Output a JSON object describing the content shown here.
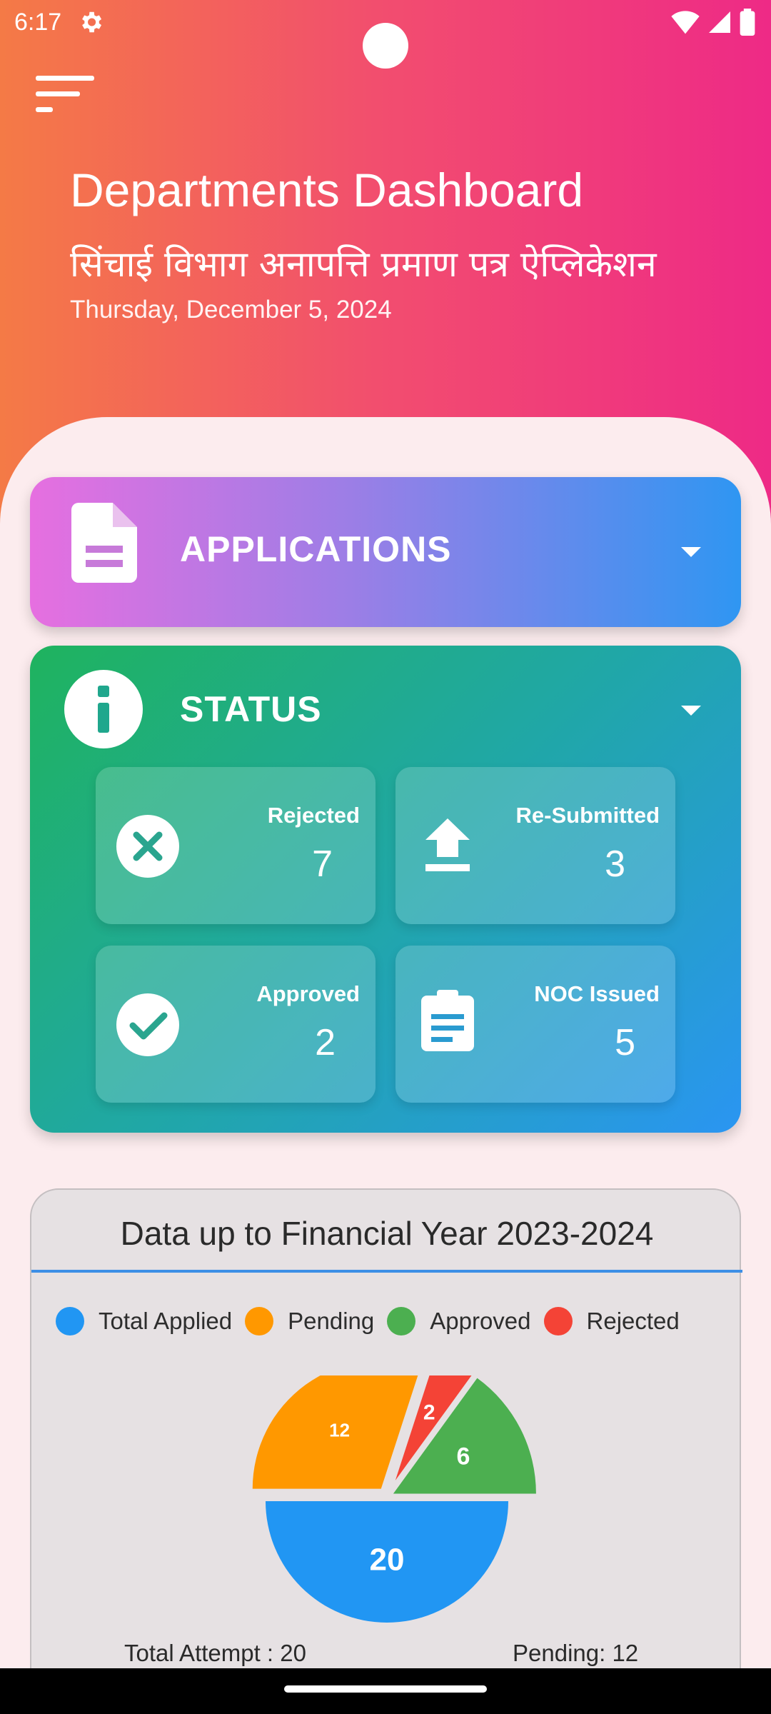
{
  "status_bar": {
    "time": "6:17"
  },
  "header": {
    "title": "Departments Dashboard",
    "subtitle": "सिंचाई विभाग अनापत्ति प्रमाण पत्र ऐप्लिकेशन",
    "date": "Thursday, December 5, 2024"
  },
  "applications": {
    "label": "APPLICATIONS"
  },
  "status": {
    "label": "STATUS",
    "tiles": [
      {
        "label": "Rejected",
        "value": "7",
        "icon": "close-circle-icon"
      },
      {
        "label": "Re-Submitted",
        "value": "3",
        "icon": "upload-icon"
      },
      {
        "label": "Approved",
        "value": "2",
        "icon": "check-circle-icon"
      },
      {
        "label": "NOC Issued",
        "value": "5",
        "icon": "clipboard-icon"
      }
    ]
  },
  "chart": {
    "title": "Data up to Financial Year 2023-2024",
    "footer_left": "Total Attempt : 20",
    "footer_right": "Pending: 12"
  },
  "colors": {
    "total_applied": "#2196f3",
    "pending": "#ff9800",
    "approved": "#4caf50",
    "rejected": "#f44336"
  },
  "chart_data": {
    "type": "pie",
    "categories": [
      "Total Applied",
      "Pending",
      "Approved",
      "Rejected"
    ],
    "values": [
      20,
      12,
      6,
      2
    ],
    "legend": "top"
  }
}
